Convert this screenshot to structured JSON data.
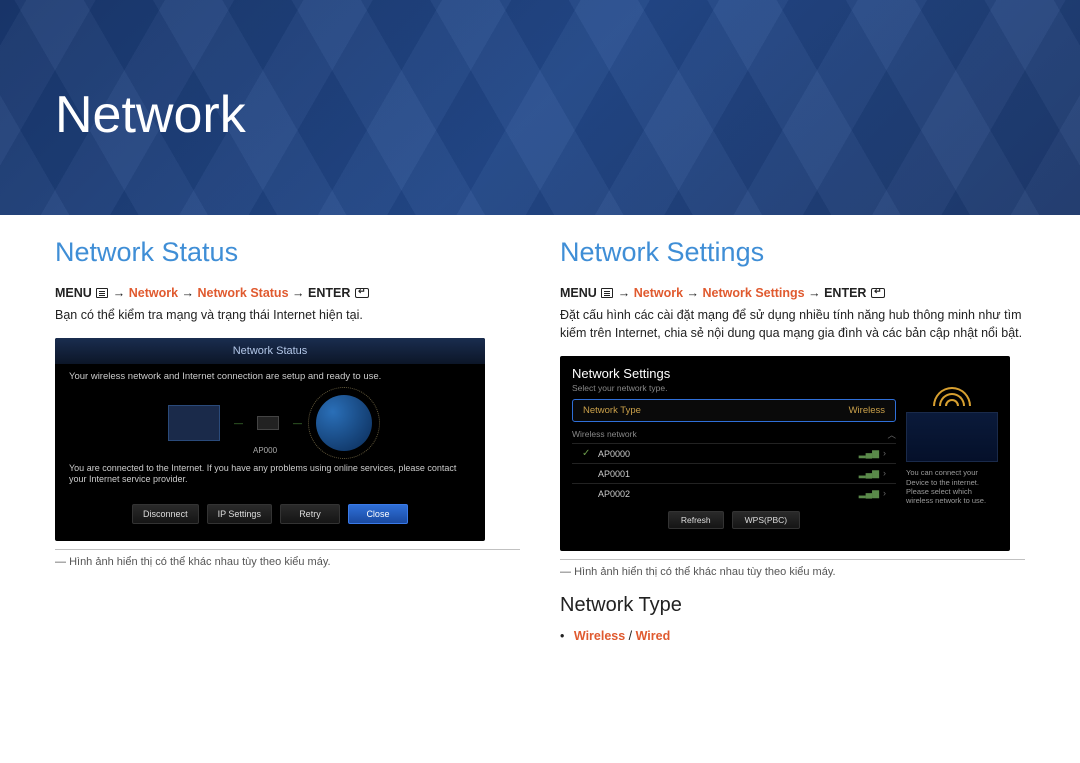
{
  "banner_title": "Network",
  "left": {
    "heading": "Network Status",
    "breadcrumb": {
      "menu": "MENU",
      "network": "Network",
      "page": "Network Status",
      "enter": "ENTER"
    },
    "desc": "Bạn có thể kiểm tra mạng và trạng thái Internet hiện tại.",
    "shot": {
      "title": "Network Status",
      "msg1": "Your wireless network and Internet connection are setup and ready to use.",
      "ap_label": "AP000",
      "msg2": "You are connected to the Internet. If you have any problems using online services, please contact your Internet service provider.",
      "buttons": [
        "Disconnect",
        "IP Settings",
        "Retry",
        "Close"
      ]
    },
    "caption": "Hình ảnh hiển thị có thể khác nhau tùy theo kiểu máy."
  },
  "right": {
    "heading": "Network Settings",
    "breadcrumb": {
      "menu": "MENU",
      "network": "Network",
      "page": "Network Settings",
      "enter": "ENTER"
    },
    "desc": "Đặt cấu hình các cài đặt mạng để sử dụng nhiều tính năng hub thông minh như tìm kiếm trên Internet, chia sẻ nội dung qua mạng gia đình và các bản cập nhật nổi bật.",
    "shot": {
      "title": "Network Settings",
      "sub": "Select your network type.",
      "nt_label": "Network Type",
      "nt_value": "Wireless",
      "wlabel": "Wireless network",
      "wifi": [
        "AP0000",
        "AP0001",
        "AP0002"
      ],
      "buttons": [
        "Refresh",
        "WPS(PBC)"
      ],
      "help": "You can connect your Device to the internet. Please select which wireless network to use."
    },
    "caption": "Hình ảnh hiển thị có thể khác nhau tùy theo kiểu máy.",
    "subhead": "Network Type",
    "options": {
      "a": "Wireless",
      "sep": " / ",
      "b": "Wired"
    }
  }
}
